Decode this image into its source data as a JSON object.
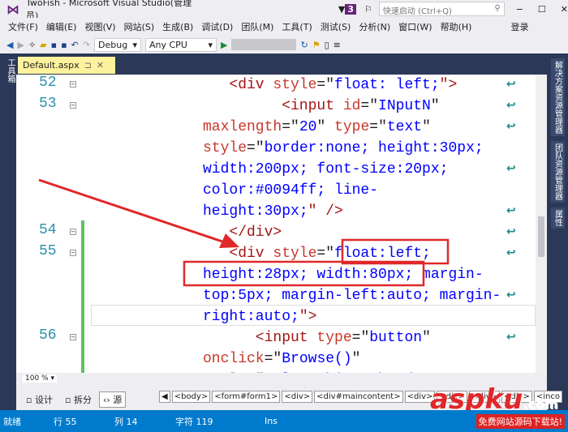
{
  "window": {
    "title": "TwoFish - Microsoft Visual Studio(管理员)",
    "notif_count": "3",
    "quick_launch_placeholder": "快速启动 (Ctrl+Q)",
    "min": "−",
    "max": "☐",
    "close": "✕"
  },
  "menu": [
    "文件(F)",
    "编辑(E)",
    "视图(V)",
    "网站(S)",
    "生成(B)",
    "调试(D)",
    "团队(M)",
    "工具(T)",
    "测试(S)",
    "分析(N)",
    "窗口(W)",
    "帮助(H)"
  ],
  "login": "登录",
  "toolbar": {
    "config": "Debug",
    "platform": "Any CPU"
  },
  "left_panel": "工具箱",
  "right_panels": [
    "解决方案资源管理器",
    "团队资源管理器",
    "属性"
  ],
  "tab": {
    "label": "Default.aspx",
    "pin": "⊐",
    "close": "✕"
  },
  "code": [
    {
      "num": "52",
      "indent": 3,
      "segs": [
        [
          "<div ",
          "tag"
        ],
        [
          "style",
          "attr"
        ],
        [
          "=\"",
          "pl"
        ],
        [
          "float: left;",
          "val"
        ],
        [
          "\">",
          "tag"
        ]
      ]
    },
    {
      "num": "53",
      "indent": 9,
      "segs": [
        [
          "<input ",
          "tag"
        ],
        [
          "id",
          "attr"
        ],
        [
          "=\"",
          "pl"
        ],
        [
          "INputN",
          "val"
        ],
        [
          "\"",
          "pl"
        ]
      ]
    },
    {
      "num": "",
      "indent": 0,
      "segs": [
        [
          "maxlength",
          "attr"
        ],
        [
          "=\"",
          "pl"
        ],
        [
          "20",
          "val"
        ],
        [
          "\" ",
          "pl"
        ],
        [
          "type",
          "attr"
        ],
        [
          "=\"",
          "pl"
        ],
        [
          "text",
          "val"
        ],
        [
          "\"",
          "pl"
        ]
      ]
    },
    {
      "num": "",
      "indent": 0,
      "segs": [
        [
          "style",
          "attr"
        ],
        [
          "=\"",
          "pl"
        ],
        [
          "border:none; height:30px;",
          "val"
        ]
      ]
    },
    {
      "num": "",
      "indent": 0,
      "segs": [
        [
          "width:200px; font-size:20px;",
          "val"
        ]
      ]
    },
    {
      "num": "",
      "indent": 0,
      "segs": [
        [
          "color:#0094ff; line-",
          "val"
        ]
      ]
    },
    {
      "num": "",
      "indent": 0,
      "segs": [
        [
          "height:30px;",
          "val"
        ],
        [
          "\" />",
          "tag"
        ]
      ]
    },
    {
      "num": "54",
      "indent": 3,
      "segs": [
        [
          "</div>",
          "tag"
        ]
      ]
    },
    {
      "num": "55",
      "indent": 3,
      "segs": [
        [
          "<div ",
          "tag"
        ],
        [
          "style",
          "attr"
        ],
        [
          "=\"",
          "pl"
        ],
        [
          "float:left;",
          "val"
        ]
      ]
    },
    {
      "num": "",
      "indent": 0,
      "segs": [
        [
          "height:28px; width:80px; margin-",
          "val"
        ]
      ]
    },
    {
      "num": "",
      "indent": 0,
      "segs": [
        [
          "top:5px; margin-left:auto; margin-",
          "val"
        ]
      ]
    },
    {
      "num": "",
      "indent": 0,
      "segs": [
        [
          "right:auto;",
          "val"
        ],
        [
          "\">",
          "tag"
        ]
      ]
    },
    {
      "num": "56",
      "indent": 6,
      "segs": [
        [
          "<input ",
          "tag"
        ],
        [
          "type",
          "attr"
        ],
        [
          "=\"",
          "pl"
        ],
        [
          "button",
          "val"
        ],
        [
          "\"",
          "pl"
        ]
      ]
    },
    {
      "num": "",
      "indent": 0,
      "segs": [
        [
          "onclick",
          "attr"
        ],
        [
          "=\"",
          "pl"
        ],
        [
          "Browse()",
          "val"
        ],
        [
          "\"",
          "pl"
        ]
      ]
    },
    {
      "num": "",
      "indent": 0,
      "segs": [
        [
          "style",
          "attr"
        ],
        [
          "=\"",
          "pl"
        ],
        [
          "color:white; border:none;",
          "val"
        ]
      ]
    }
  ],
  "zoom": "100 %",
  "views": {
    "design": "设计",
    "split": "拆分",
    "source": "源"
  },
  "breadcrumbs": [
    "<body>",
    "<form#form1>",
    "<div>",
    "<div#maincontent>",
    "<div>",
    "<div>",
    "<div>",
    "<div>",
    "<inco"
  ],
  "status": {
    "ready": "就绪",
    "line": "行 55",
    "col": "列 14",
    "char": "字符 119",
    "mode": "Ins"
  },
  "watermark": {
    "brand": "aspku",
    "suffix": ".com",
    "tagline": "免费网站源码下载站!"
  },
  "colors": {
    "accent": "#007acc",
    "highlight": "#fff29d",
    "annotation": "#e0282a"
  }
}
